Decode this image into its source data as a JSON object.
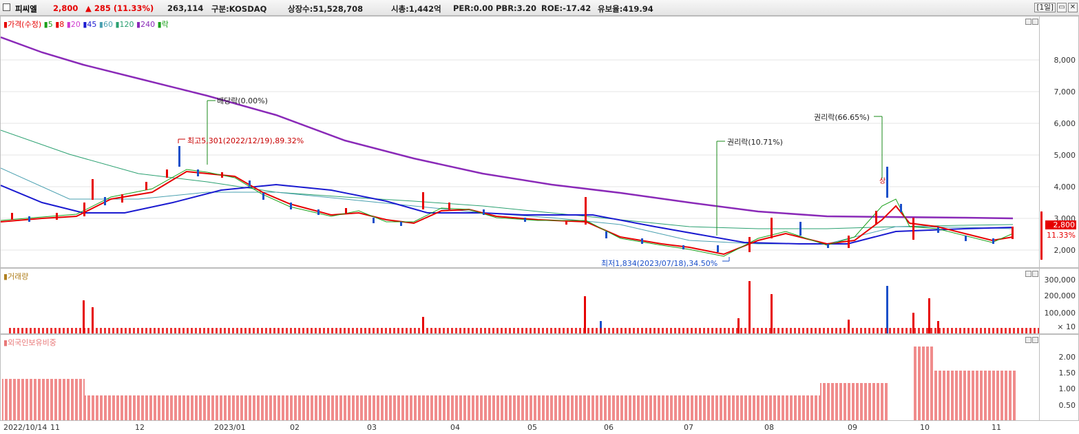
{
  "header": {
    "name": "피씨엘",
    "price": "2,800",
    "change": "▲ 285 (11.33%)",
    "volume": "263,114",
    "market": "구분:KOSDAQ",
    "listed": "상장수:51,528,708",
    "mcap": "시총:1,442억",
    "per": "PER:0.00",
    "pbr": "PBR:3.20",
    "roe": "ROE:-17.42",
    "reserve": "유보율:419.94",
    "period_label": "[1일]",
    "colors": {
      "up": "#e60000",
      "down": "#1a4fc9",
      "name": "#000000"
    }
  },
  "price_pane": {
    "legend": {
      "price": "가격(수정)",
      "ma5": "5",
      "ma8": "8",
      "ma20": "20",
      "ma45": "45",
      "ma60": "60",
      "ma120": "120",
      "ma240": "240",
      "drop": "락"
    },
    "yaxis": [
      "8,000",
      "7,000",
      "6,000",
      "5,000",
      "4,000",
      "3,000",
      "2,000"
    ],
    "current_price_tag": "2,800",
    "current_pct_tag": "11.33%",
    "annotations": {
      "dividend": "배당락(0.00%)",
      "high": "최고5,301(2022/12/19),89.32%",
      "rights1": "권리락(10.71%)",
      "rights2": "권리락(66.65%)",
      "low": "최저1,834(2023/07/18),34.50%",
      "sang": "상"
    },
    "colors": {
      "ma5": "#1aa01a",
      "ma8": "#e60000",
      "ma20": "#d03bd0",
      "ma45": "#1a1ad0",
      "ma60": "#4aa0b0",
      "ma120": "#2aa070",
      "ma240": "#8a2ab8"
    }
  },
  "volume_pane": {
    "legend": "거래량",
    "yaxis": [
      "300,000",
      "200,000",
      "100,000"
    ],
    "unit": "× 10"
  },
  "foreign_pane": {
    "legend": "외국인보유비중",
    "yaxis": [
      "2.00",
      "1.50",
      "1.00",
      "0.50"
    ]
  },
  "xaxis": {
    "labels": [
      "2022/10/14",
      "11",
      "12",
      "2023/01",
      "02",
      "03",
      "04",
      "05",
      "06",
      "07",
      "08",
      "09",
      "10",
      "11"
    ]
  }
}
